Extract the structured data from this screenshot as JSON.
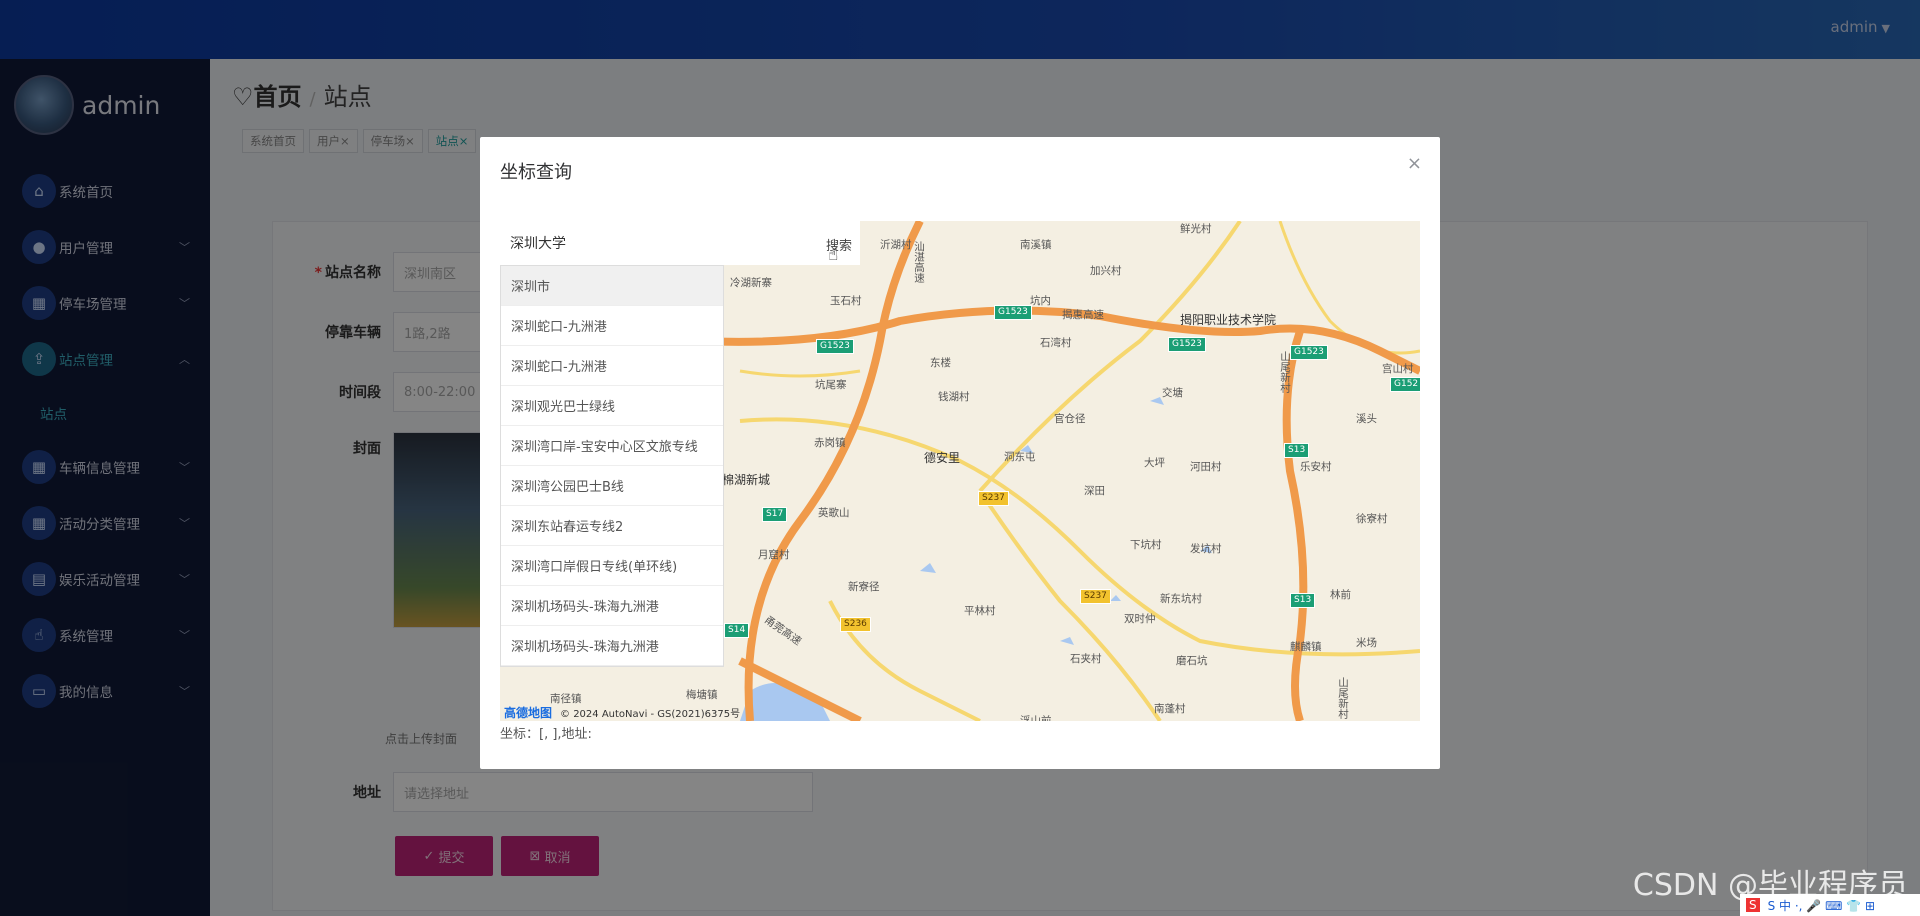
{
  "header": {
    "user_label": "admin",
    "caret": "▼"
  },
  "sidebar": {
    "username": "admin",
    "items": [
      {
        "label": "系统首页",
        "icon": "home-icon"
      },
      {
        "label": "用户管理",
        "icon": "bulb-icon"
      },
      {
        "label": "停车场管理",
        "icon": "grid-icon"
      },
      {
        "label": "站点管理",
        "icon": "upload-icon"
      },
      {
        "label": "车辆信息管理",
        "icon": "grid-icon"
      },
      {
        "label": "活动分类管理",
        "icon": "grid-icon"
      },
      {
        "label": "娱乐活动管理",
        "icon": "building-icon"
      },
      {
        "label": "系统管理",
        "icon": "thumb-icon"
      },
      {
        "label": "我的信息",
        "icon": "card-icon"
      }
    ],
    "submenu_label": "站点"
  },
  "breadcrumb": {
    "home": "首页",
    "sep": "/",
    "current": "站点"
  },
  "tabs": [
    "系统首页",
    "用户",
    "停车场",
    "站点"
  ],
  "form": {
    "station_name_label": "站点名称",
    "station_name_placeholder": "深圳南区",
    "vehicles_label": "停靠车辆",
    "vehicles_placeholder": "1路,2路",
    "period_label": "时间段",
    "period_placeholder": "8:00-22:00",
    "cover_label": "封面",
    "upload_hint": "点击上传封面",
    "address_label": "地址",
    "address_placeholder": "请选择地址",
    "submit_label": "提交",
    "cancel_label": "取消"
  },
  "dialog": {
    "title": "坐标查询",
    "close": "×",
    "search_value": "深圳大学",
    "search_button": "搜索",
    "suggestions": [
      "深圳市",
      "深圳蛇口-九洲港",
      "深圳蛇口-九洲港",
      "深圳观光巴士绿线",
      "深圳湾口岸-宝安中心区文旅专线",
      "深圳湾公园巴士B线",
      "深圳东站春运专线2",
      "深圳湾口岸假日专线(单环线)",
      "深圳机场码头-珠海九洲港",
      "深圳机场码头-珠海九洲港"
    ],
    "map_logo": "高德地图",
    "map_copyright": "© 2024 AutoNavi - GS(2021)6375号",
    "coord_text": "坐标：[, ],地址:"
  },
  "map_labels": {
    "places": [
      "沂湖村",
      "南溪镇",
      "鲜光村",
      "加兴村",
      "冷湖新寨",
      "玉石村",
      "坑内",
      "揭阳职业技术学院",
      "石湾村",
      "东楼",
      "坑尾寨",
      "钱湖村",
      "官仓径",
      "交塘",
      "宫山村",
      "溪头",
      "赤岗镇",
      "德安里",
      "洞东屯",
      "大坪",
      "河田村",
      "乐安村",
      "棉湖新城",
      "英歌山",
      "深田",
      "下坑村",
      "徐寮村",
      "月窟村",
      "发坑村",
      "新寮径",
      "平林村",
      "新东坑村",
      "林前",
      "双时仲",
      "麒麟镇",
      "米场",
      "石夹村",
      "磨石坑",
      "南蓬村",
      "南径镇",
      "梅塘镇",
      "浮山前",
      "山尾新村",
      "揭惠高速",
      "甬莞高速",
      "汕湛高速",
      "揭普惠高速"
    ],
    "shields": [
      "G1523",
      "G1523",
      "G1523",
      "G1523",
      "G152",
      "S13",
      "S13",
      "S237",
      "S237",
      "S17",
      "S14",
      "S236"
    ]
  },
  "footer": {
    "watermark": "CSDN @毕业程序员",
    "ime_text": "S 中 ·, 🎤 ⌨ 👕 ⊞"
  }
}
